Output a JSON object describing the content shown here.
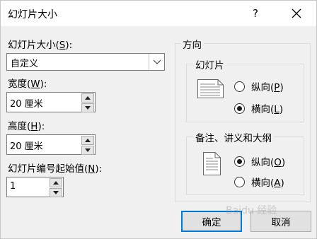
{
  "window": {
    "title": "幻灯片大小",
    "help_label": "?",
    "close_icon": "close-icon"
  },
  "left": {
    "size_label_pre": "幻灯片大小(",
    "size_label_key": "S",
    "size_label_post": "):",
    "size_value": "自定义",
    "width_label_pre": "宽度(",
    "width_label_key": "W",
    "width_label_post": "):",
    "width_value": "20 厘米",
    "height_label_pre": "高度(",
    "height_label_key": "H",
    "height_label_post": "):",
    "height_value": "20 厘米",
    "number_label_pre": "幻灯片编号起始值(",
    "number_label_key": "N",
    "number_label_post": "):",
    "number_value": "1"
  },
  "orientation": {
    "title": "方向",
    "slides": {
      "title": "幻灯片",
      "portrait_pre": "纵向(",
      "portrait_key": "P",
      "portrait_post": ")",
      "portrait_selected": false,
      "landscape_pre": "横向(",
      "landscape_key": "L",
      "landscape_post": ")",
      "landscape_selected": true
    },
    "notes": {
      "title": "备注、讲义和大纲",
      "portrait_pre": "纵向(",
      "portrait_key": "O",
      "portrait_post": ")",
      "portrait_selected": true,
      "landscape_pre": "横向(",
      "landscape_key": "A",
      "landscape_post": ")",
      "landscape_selected": false
    }
  },
  "buttons": {
    "ok": "确定",
    "cancel": "取消"
  },
  "watermark": "Baidu 经验",
  "colors": {
    "accent": "#0078d7",
    "background": "#f0f0f0"
  }
}
